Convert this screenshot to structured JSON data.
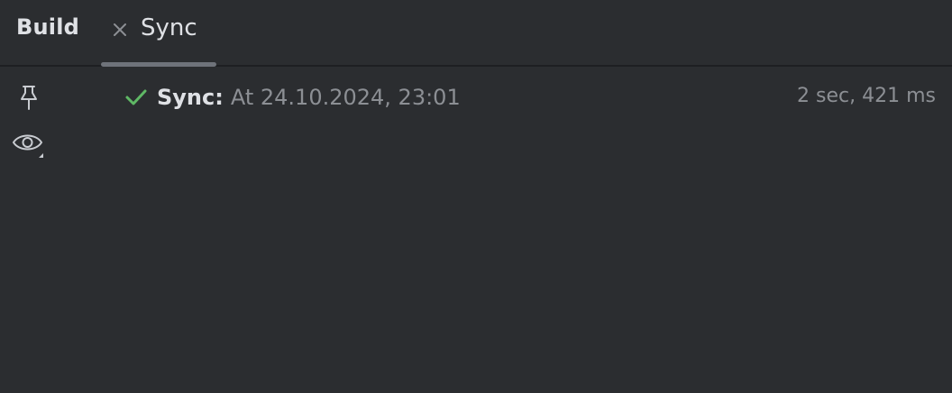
{
  "panel": {
    "title": "Build"
  },
  "tabs": [
    {
      "label": "Sync",
      "icon": "close-icon",
      "selected": true
    }
  ],
  "toolbar": {
    "buttons": [
      {
        "icon": "pin-icon"
      },
      {
        "icon": "eye-icon"
      }
    ]
  },
  "tree": {
    "root": {
      "status_icon": "check-icon",
      "status_color": "#5fb865",
      "title": "Sync:",
      "detail": "At 24.10.2024, 23:01",
      "duration": "2 sec, 421 ms"
    }
  },
  "colors": {
    "background": "#2b2d30",
    "tab_underline": "#6f737a",
    "success": "#5fb865",
    "muted_text": "#8c8f94"
  }
}
